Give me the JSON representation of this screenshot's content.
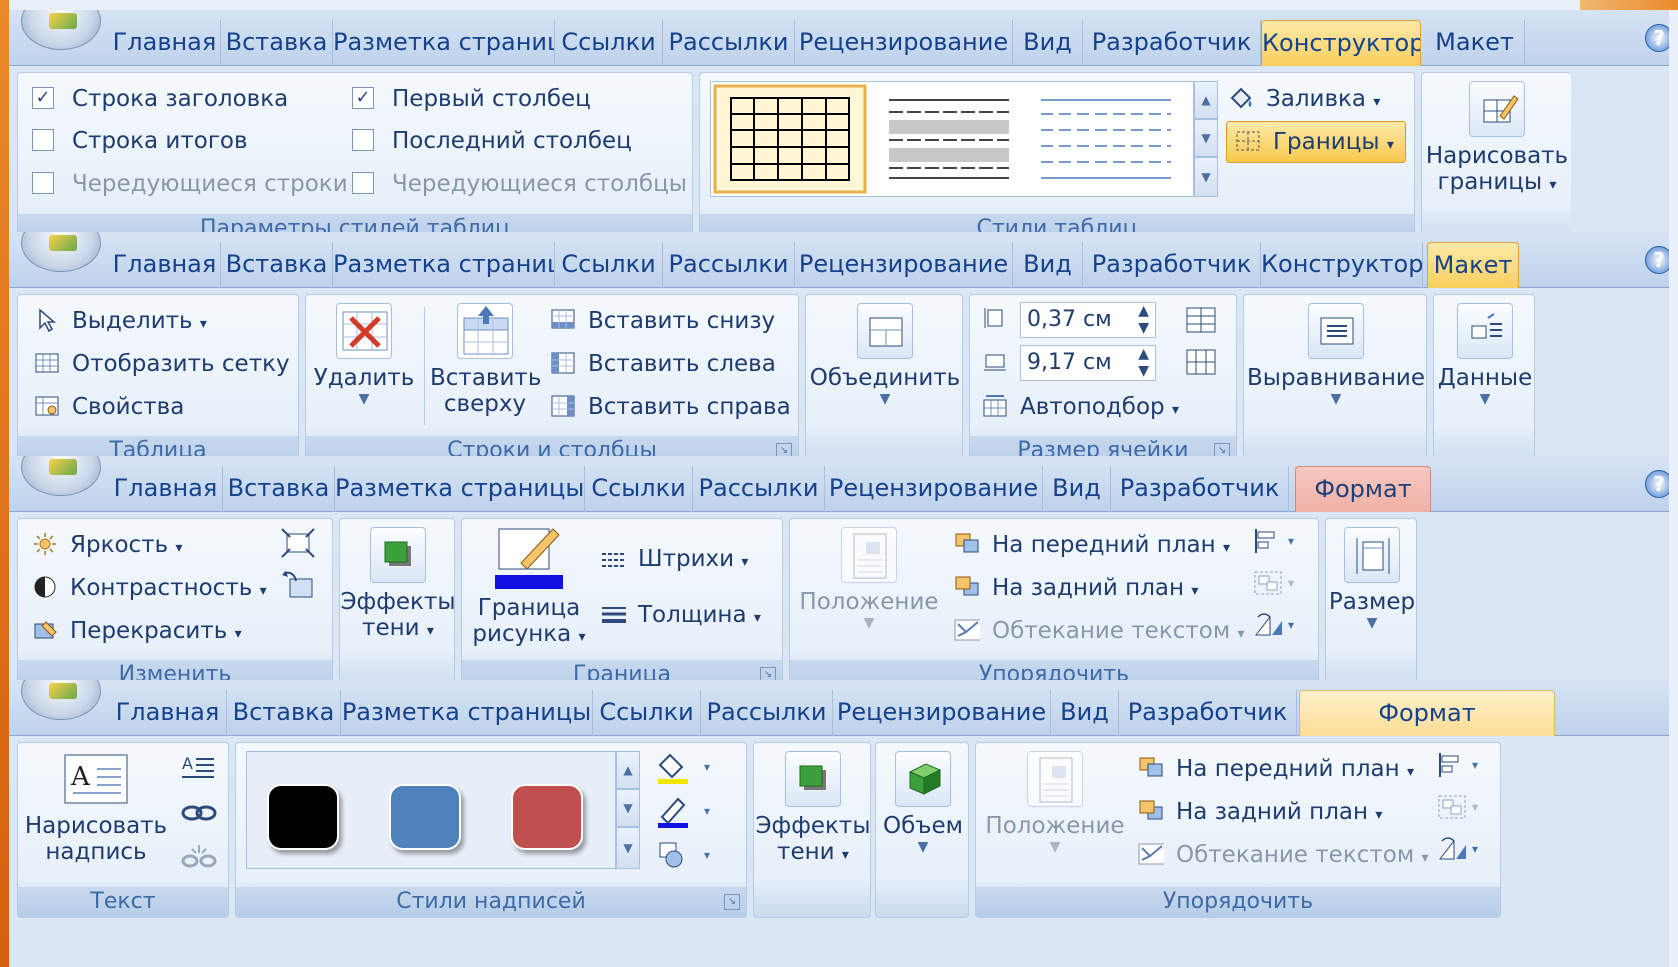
{
  "tabs": {
    "home": "Главная",
    "insert": "Вставка",
    "layout_short": "Разметка страниц",
    "layout_full": "Разметка страницы",
    "refs": "Ссылки",
    "mail": "Рассылки",
    "review": "Рецензирование",
    "view": "Вид",
    "dev": "Разработчик",
    "design": "Конструктор",
    "table_layout": "Макет",
    "format": "Формат",
    "help": "?"
  },
  "strip1": {
    "opts": {
      "header_row": "Строка заголовка",
      "first_col": "Первый столбец",
      "total_row": "Строка итогов",
      "last_col": "Последний столбец",
      "banded_rows": "Чередующиеся строки",
      "banded_cols": "Чередующиеся столбцы",
      "check": "✓",
      "label": "Параметры стилей таблиц"
    },
    "styles": {
      "fill": "Заливка",
      "borders": "Границы",
      "label": "Стили таблиц"
    },
    "draw": {
      "line1": "Нарисовать",
      "line2": "границы"
    }
  },
  "strip2": {
    "table": {
      "select": "Выделить",
      "grid": "Отобразить сетку",
      "props": "Свойства",
      "label": "Таблица"
    },
    "rows": {
      "delete": "Удалить",
      "insert_above1": "Вставить",
      "insert_above2": "сверху",
      "below": "Вставить снизу",
      "left": "Вставить слева",
      "right": "Вставить справа",
      "label": "Строки и столбцы"
    },
    "merge": "Объединить",
    "size": {
      "height": "0,37 см",
      "width": "9,17 см",
      "autofit": "Автоподбор",
      "label": "Размер ячейки"
    },
    "align": "Выравнивание",
    "data": "Данные"
  },
  "strip3": {
    "adjust": {
      "brightness": "Яркость",
      "contrast": "Контрастность",
      "recolor": "Перекрасить",
      "label": "Изменить"
    },
    "shadow": {
      "line1": "Эффекты",
      "line2": "тени"
    },
    "border": {
      "line1": "Граница",
      "line2": "рисунка",
      "dashes": "Штрихи",
      "weight": "Толщина",
      "label": "Граница"
    },
    "arrange": {
      "position": "Положение",
      "front": "На передний план",
      "back": "На задний план",
      "wrap": "Обтекание текстом",
      "label": "Упорядочить"
    },
    "size": "Размер"
  },
  "strip4": {
    "text": {
      "line1": "Нарисовать",
      "line2": "надпись",
      "label": "Текст"
    },
    "styles": {
      "label": "Стили надписей",
      "colors": [
        "#000000",
        "#4f81bd",
        "#c0504d"
      ]
    },
    "shadow": {
      "line1": "Эффекты",
      "line2": "тени"
    },
    "three_d": "Объем",
    "arrange": {
      "position": "Положение",
      "front": "На передний план",
      "back": "На задний план",
      "wrap": "Обтекание текстом",
      "label": "Упорядочить"
    }
  }
}
